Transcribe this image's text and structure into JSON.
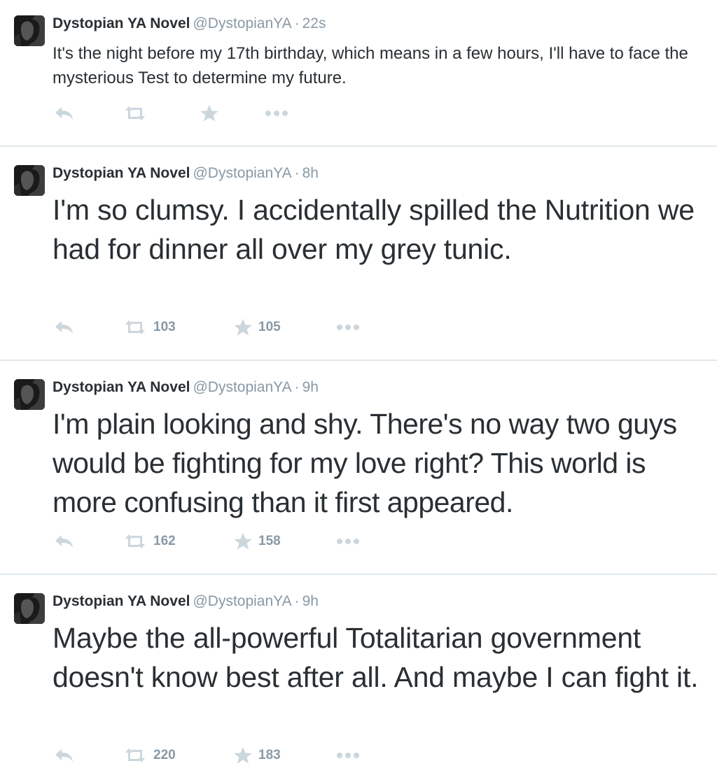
{
  "tweets": [
    {
      "name": "Dystopian YA Novel",
      "handle": "@DystopianYA",
      "separator": "·",
      "time": "22s",
      "text": "It's the night before my 17th birthday, which means in a few hours, I'll have to face the mysterious Test to determine my future.",
      "retweets": "",
      "favorites": ""
    },
    {
      "name": "Dystopian YA Novel",
      "handle": "@DystopianYA",
      "separator": "·",
      "time": "8h",
      "text": "I'm so clumsy. I accidentally spilled the Nutrition we had for dinner all over my grey tunic.",
      "retweets": "103",
      "favorites": "105"
    },
    {
      "name": "Dystopian YA Novel",
      "handle": "@DystopianYA",
      "separator": "·",
      "time": "9h",
      "text": "I'm plain looking and shy. There's no way two guys would be fighting for my love right? This world is more confusing than it first appeared.",
      "retweets": "162",
      "favorites": "158"
    },
    {
      "name": "Dystopian YA Novel",
      "handle": "@DystopianYA",
      "separator": "·",
      "time": "9h",
      "text": "Maybe the all-powerful Totalitarian government doesn't know best after all. And maybe I can fight it.",
      "retweets": "220",
      "favorites": "183"
    }
  ],
  "icons": {
    "reply": "reply-icon",
    "retweet": "retweet-icon",
    "favorite": "star-icon",
    "more": "more-icon"
  },
  "colors": {
    "text": "#292f33",
    "muted": "#8899a6",
    "icon": "#ccd6dd",
    "divider": "#e1e8ed"
  }
}
